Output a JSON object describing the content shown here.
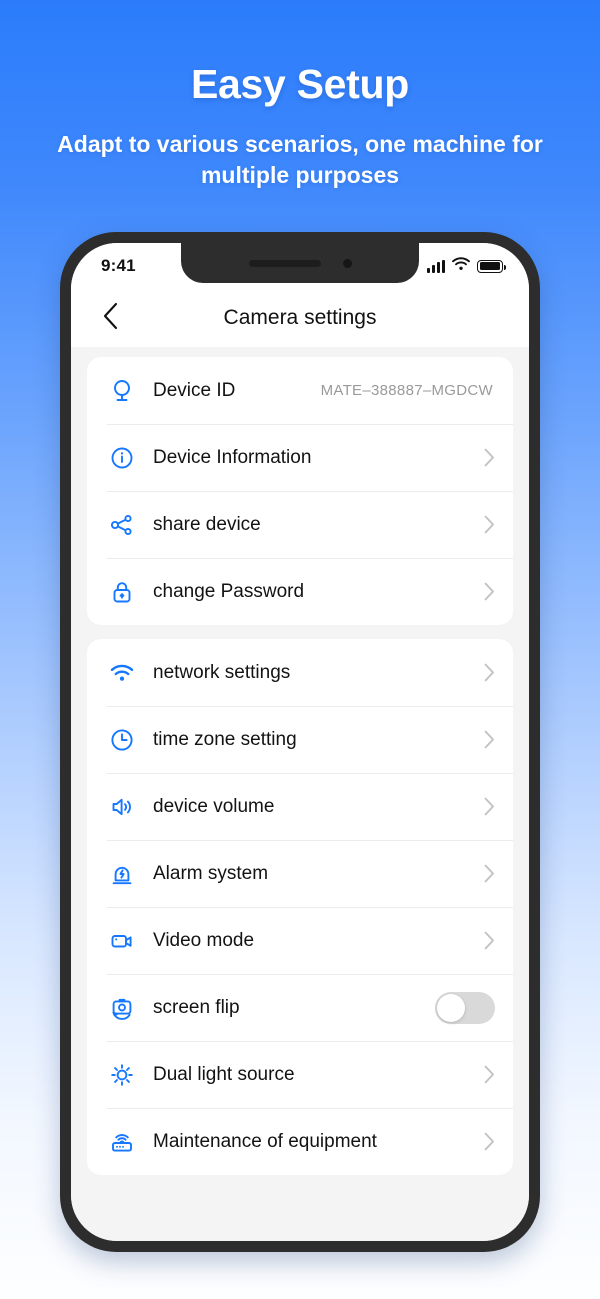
{
  "promo": {
    "title": "Easy Setup",
    "subtitle": "Adapt to various scenarios, one machine for multiple purposes"
  },
  "colors": {
    "accent": "#1677ff",
    "bg_top": "#2b7cfb",
    "bg_bottom": "#fdfeff",
    "frame": "#2d2d2d",
    "screen_bg": "#f4f4f5",
    "toggle_off": "#d9d9d9"
  },
  "phone": {
    "status_bar": {
      "time": "9:41",
      "signal_icon": "cellular-bars-icon",
      "wifi_icon": "wifi-icon",
      "battery_icon": "battery-full-icon"
    },
    "nav": {
      "back_icon": "chevron-left-icon",
      "title": "Camera settings"
    }
  },
  "groups": [
    {
      "rows": [
        {
          "icon": "dome-camera-icon",
          "label": "Device ID",
          "value": "MATE–388887–MGDCW",
          "accessory": "none"
        },
        {
          "icon": "info-circle-icon",
          "label": "Device Information",
          "value": "",
          "accessory": "chevron"
        },
        {
          "icon": "share-nodes-icon",
          "label": "share device",
          "value": "",
          "accessory": "chevron"
        },
        {
          "icon": "lock-icon",
          "label": "change Password",
          "value": "",
          "accessory": "chevron"
        }
      ]
    },
    {
      "rows": [
        {
          "icon": "wifi-icon",
          "label": "network settings",
          "value": "",
          "accessory": "chevron"
        },
        {
          "icon": "clock-icon",
          "label": "time zone setting",
          "value": "",
          "accessory": "chevron"
        },
        {
          "icon": "speaker-volume-icon",
          "label": "device volume",
          "value": "",
          "accessory": "chevron"
        },
        {
          "icon": "siren-alarm-icon",
          "label": "Alarm system",
          "value": "",
          "accessory": "chevron"
        },
        {
          "icon": "video-camera-icon",
          "label": "Video mode",
          "value": "",
          "accessory": "chevron"
        },
        {
          "icon": "screen-flip-icon",
          "label": "screen flip",
          "value": "",
          "accessory": "toggle",
          "toggle_on": false
        },
        {
          "icon": "sun-brightness-icon",
          "label": "Dual light source",
          "value": "",
          "accessory": "chevron"
        },
        {
          "icon": "router-icon",
          "label": "Maintenance of equipment",
          "value": "",
          "accessory": "chevron"
        }
      ]
    }
  ]
}
